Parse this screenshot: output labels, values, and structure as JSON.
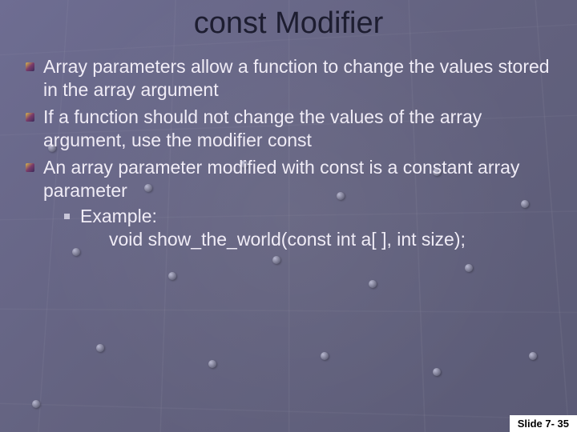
{
  "title": "const Modifier",
  "bullets": [
    "Array parameters allow a function to change the values stored in the array argument",
    "If a function should not change the values of the array argument, use the modifier const",
    "An array parameter modified with const is a constant array parameter"
  ],
  "example": {
    "label": "Example:",
    "code": "void show_the_world(const int a[ ], int size);"
  },
  "footer": "Slide 7- 35"
}
